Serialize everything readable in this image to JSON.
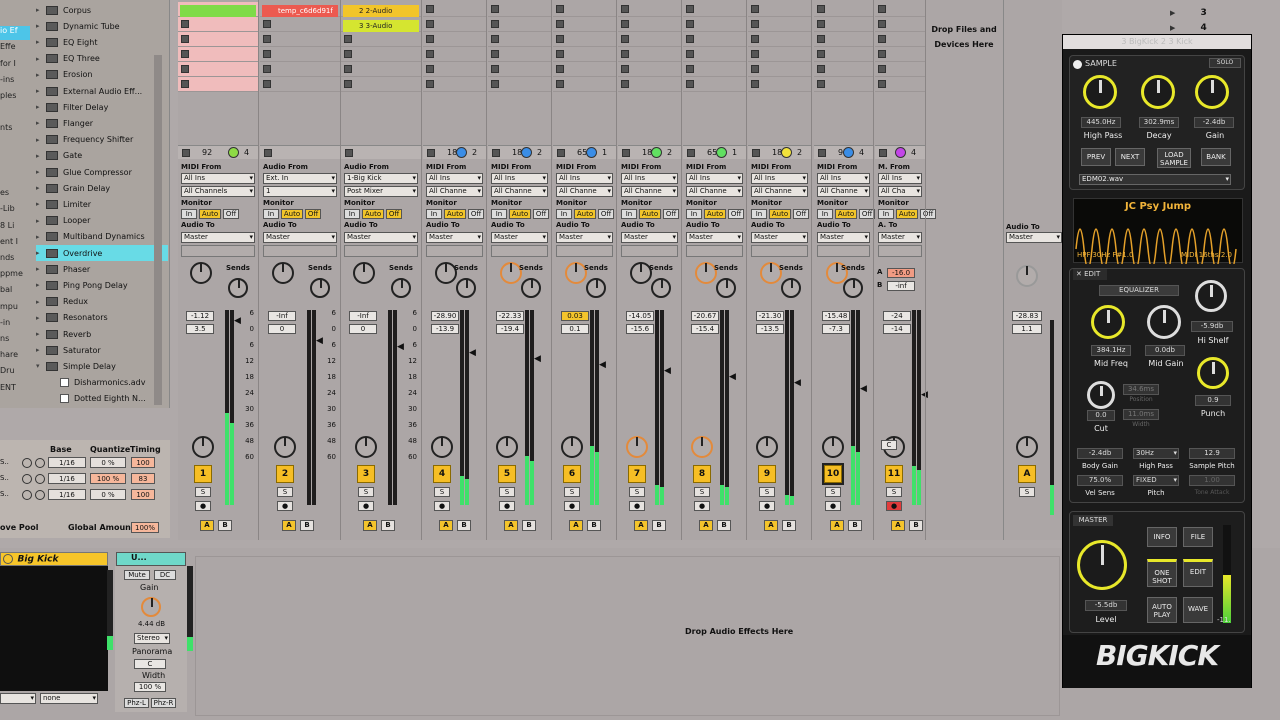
{
  "browser": {
    "items": [
      {
        "label": "Corpus",
        "type": "folder"
      },
      {
        "label": "Dynamic Tube",
        "type": "folder"
      },
      {
        "label": "EQ Eight",
        "type": "folder"
      },
      {
        "label": "EQ Three",
        "type": "folder"
      },
      {
        "label": "Erosion",
        "type": "folder"
      },
      {
        "label": "External Audio Eff...",
        "type": "folder"
      },
      {
        "label": "Filter Delay",
        "type": "folder"
      },
      {
        "label": "Flanger",
        "type": "folder"
      },
      {
        "label": "Frequency Shifter",
        "type": "folder"
      },
      {
        "label": "Gate",
        "type": "folder"
      },
      {
        "label": "Glue Compressor",
        "type": "folder"
      },
      {
        "label": "Grain Delay",
        "type": "folder"
      },
      {
        "label": "Limiter",
        "type": "folder"
      },
      {
        "label": "Looper",
        "type": "folder"
      },
      {
        "label": "Multiband Dynamics",
        "type": "folder"
      },
      {
        "label": "Overdrive",
        "type": "folder",
        "selected": true
      },
      {
        "label": "Phaser",
        "type": "folder"
      },
      {
        "label": "Ping Pong Delay",
        "type": "folder"
      },
      {
        "label": "Redux",
        "type": "folder"
      },
      {
        "label": "Resonators",
        "type": "folder"
      },
      {
        "label": "Reverb",
        "type": "folder"
      },
      {
        "label": "Saturator",
        "type": "folder"
      },
      {
        "label": "Simple Delay",
        "type": "folder",
        "open": true
      },
      {
        "label": "Disharmonics.adv",
        "type": "file"
      },
      {
        "label": "Dotted Eighth N...",
        "type": "file"
      }
    ],
    "left_col": [
      "",
      "io Ef",
      "Effe",
      "for I",
      "-ins",
      "ples",
      "",
      "nts",
      "",
      "",
      "",
      "es",
      "-Lib",
      "8 Li",
      "ent I",
      "nds",
      "ppme",
      "bal",
      "mpu",
      "-in",
      "ns",
      "hare",
      "Dru",
      "ENT"
    ]
  },
  "groove": {
    "headers": [
      "Name",
      "Base",
      "Quantize",
      "Timing"
    ],
    "rows": [
      {
        "prefix": "S..",
        "base": "1/16",
        "quantize": "0 %",
        "timing": "100"
      },
      {
        "prefix": "S..",
        "base": "1/16",
        "quantize": "100 %",
        "timing": "83"
      },
      {
        "prefix": "S..",
        "base": "1/16",
        "quantize": "0 %",
        "timing": "100"
      }
    ],
    "pool_label": "ove Pool",
    "global_amount_label": "Global Amount",
    "global_amount": "100%"
  },
  "clips": {
    "t2_row1": "temp_c6d6d91f",
    "t3_row1": "2 2-Audio",
    "t3_row2": "3 3-Audio"
  },
  "drop_files": "Drop Files and Devices Here",
  "scene_numbers": [
    "3",
    "4"
  ],
  "tracks": [
    {
      "hdr_num": "92",
      "hdr_num2": "4",
      "from_label": "MIDI From",
      "from": "All Ins",
      "chan": "All Channels",
      "to_label": "Audio To",
      "to": "Master",
      "vol": "-1.12",
      "pan": "3.5",
      "num": "1",
      "meter": 0.47
    },
    {
      "hdr_num": "",
      "hdr_num2": "",
      "from_label": "Audio From",
      "from": "Ext. In",
      "chan": "1",
      "to_label": "Audio To",
      "to": "Master",
      "vol": "-Inf",
      "pan": "0",
      "num": "2",
      "meter": 0
    },
    {
      "hdr_num": "",
      "hdr_num2": "",
      "from_label": "Audio From",
      "from": "1-Big Kick",
      "chan": "Post Mixer",
      "to_label": "Audio To",
      "to": "Master",
      "vol": "-Inf",
      "pan": "0",
      "num": "3",
      "meter": 0
    },
    {
      "hdr_num": "183",
      "hdr_num2": "2",
      "from_label": "MIDI From",
      "from": "All Ins",
      "chan": "All Channe",
      "to_label": "Audio To",
      "to": "Master",
      "vol": "-28.90",
      "pan": "-13.9",
      "num": "4",
      "meter": 0.15
    },
    {
      "hdr_num": "183",
      "hdr_num2": "2",
      "from_label": "MIDI From",
      "from": "All Ins",
      "chan": "All Channe",
      "to_label": "Audio To",
      "to": "Master",
      "vol": "-22.33",
      "pan": "-19.4",
      "num": "5",
      "meter": 0.25
    },
    {
      "hdr_num": "65",
      "hdr_num2": "1",
      "from_label": "MIDI From",
      "from": "All Ins",
      "chan": "All Channe",
      "to_label": "Audio To",
      "to": "Master",
      "vol": "0.03",
      "pan": "0.1",
      "num": "6",
      "meter": 0.3
    },
    {
      "hdr_num": "183",
      "hdr_num2": "2",
      "from_label": "MIDI From",
      "from": "All Ins",
      "chan": "All Channe",
      "to_label": "Audio To",
      "to": "Master",
      "vol": "-14.05",
      "pan": "-15.6",
      "num": "7",
      "meter": 0.1
    },
    {
      "hdr_num": "65",
      "hdr_num2": "1",
      "from_label": "MIDI From",
      "from": "All Ins",
      "chan": "All Channe",
      "to_label": "Audio To",
      "to": "Master",
      "vol": "-20.67",
      "pan": "-15.4",
      "num": "8",
      "meter": 0.1
    },
    {
      "hdr_num": "183",
      "hdr_num2": "2",
      "from_label": "MIDI From",
      "from": "All Ins",
      "chan": "All Channe",
      "to_label": "Audio To",
      "to": "Master",
      "vol": "-21.30",
      "pan": "-13.5",
      "num": "9",
      "meter": 0.05
    },
    {
      "hdr_num": "92",
      "hdr_num2": "4",
      "from_label": "MIDI From",
      "from": "All Ins",
      "chan": "All Channe",
      "to_label": "Audio To",
      "to": "Master",
      "vol": "-15.48",
      "pan": "-7.3",
      "num": "10",
      "meter": 0.3
    },
    {
      "hdr_num": "2",
      "hdr_num2": "4",
      "from_label": "M. From",
      "from": "All Ins",
      "chan": "All Cha",
      "to_label": "A. To",
      "to": "Master",
      "vol": "-24",
      "pan": "-14",
      "num": "11",
      "meter": 0.2
    }
  ],
  "master_track": {
    "to_label": "Audio To",
    "to": "Master",
    "vol": "-28.83",
    "pan": "1.1",
    "num": "A"
  },
  "sends_label": "Sends",
  "send_a_val": "-16.0",
  "send_b_val": "-inf",
  "monitor": {
    "label": "Monitor",
    "in": "In",
    "auto": "Auto",
    "off": "Off"
  },
  "scale": [
    "6",
    "0",
    "6",
    "12",
    "18",
    "24",
    "30",
    "36",
    "48",
    "60"
  ],
  "device": {
    "title": "Big Kick",
    "util_title": "U...",
    "mute": "Mute",
    "dc": "DC",
    "gain_label": "Gain",
    "gain": "4.44 dB",
    "stereo": "Stereo",
    "panorama": "Panorama",
    "pan": "C",
    "width_label": "Width",
    "width": "100 %",
    "phz_l": "Phz-L",
    "phz_r": "Phz-R",
    "drop_fx": "Drop Audio Effects Here",
    "none": "none"
  },
  "bigkick": {
    "header": "3 BigKick 2 3 Kick",
    "sample": "SAMPLE",
    "solo": "SOLO",
    "hp_val": "445.0Hz",
    "decay_val": "302.9ms",
    "gain_val": "-2.4db",
    "hp": "High Pass",
    "decay": "Decay",
    "gain": "Gain",
    "prev": "PREV",
    "next": "NEXT",
    "load": "LOAD SAMPLE",
    "bank": "BANK",
    "file": "EDM02.wav",
    "wave_title": "JC Psy Jump",
    "wave_info1": "HPF:30Hz F#1.0",
    "wave_info2": "MIDI 16ths:2.0",
    "edit": "EDIT",
    "equalizer": "EQUALIZER",
    "mid_freq_val": "384.1Hz",
    "mid_gain_val": "0.0db",
    "hishelf_val": "-5.9db",
    "mid_freq": "Mid Freq",
    "mid_gain": "Mid Gain",
    "hishelf": "Hi Shelf",
    "cut": "Cut",
    "cut_val": "0.0",
    "punch": "Punch",
    "punch_val": "0.9",
    "pos_val": "34.6ms",
    "pos": "Position",
    "width_val": "11.0ms",
    "width": "Width",
    "body_gain_val": "-2.4db",
    "hp2_val": "30Hz",
    "pitch_val": "12.9",
    "body_gain": "Body Gain",
    "hp2": "High Pass",
    "sample_pitch": "Sample Pitch",
    "vel_val": "75.0%",
    "fixed": "FIXED",
    "tone_val": "1.00",
    "vel": "Vel Sens",
    "pitch": "Pitch",
    "tone": "Tone Attack",
    "master": "MASTER",
    "info": "INFO",
    "filebtn": "FILE",
    "oneshot": "ONE SHOT",
    "editbtn": "EDIT",
    "autoplay": "AUTO PLAY",
    "wave": "WAVE",
    "level_val": "-5.5db",
    "level": "Level",
    "meter_val": "-11.",
    "logo": "BIGKICK"
  }
}
